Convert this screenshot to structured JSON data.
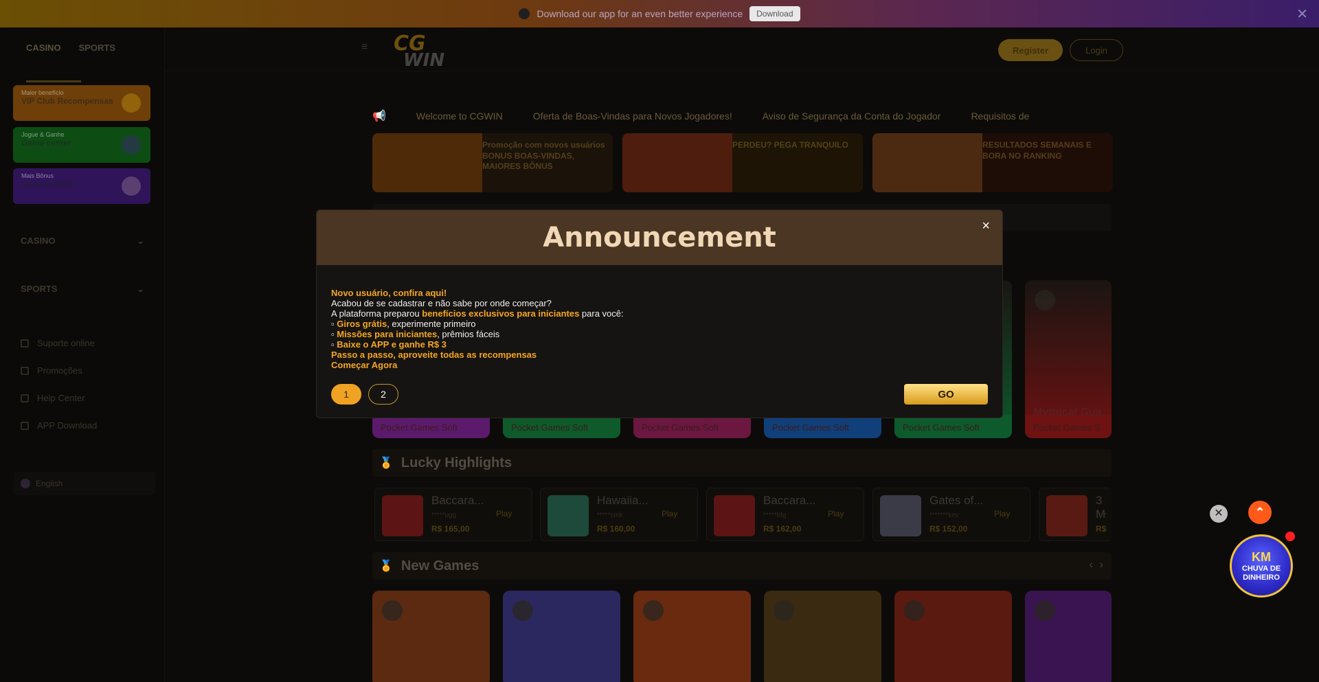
{
  "topbar": {
    "promo_text": "Download our app for an even better experience",
    "download_label": "Download",
    "close_glyph": "✕"
  },
  "sidebar": {
    "tabs": [
      {
        "label": "CASINO",
        "icon": "casino-icon"
      },
      {
        "label": "SPORTS",
        "icon": "sports-icon"
      }
    ],
    "promos": [
      {
        "sub": "Maior benefício",
        "label": "VIP Club Recompensas"
      },
      {
        "sub": "Jogue & Ganhe",
        "label": "Game center"
      },
      {
        "sub": "Mais Bônus",
        "label": "Invite Friends"
      }
    ],
    "sections": [
      "CASINO",
      "SPORTS"
    ],
    "links": [
      "Suporte online",
      "Promoções",
      "Help Center",
      "APP Download"
    ],
    "language": "English"
  },
  "header": {
    "logo_top": "CG",
    "logo_bottom": "WIN",
    "register_label": "Register",
    "login_label": "Login"
  },
  "marquee": [
    "Welcome to CGWIN",
    "Oferta de Boas-Vindas para Novos Jogadores!",
    "Aviso de Segurança da Conta do Jogador",
    "Requisitos de"
  ],
  "banners": [
    {
      "text": "Promoção com novos usuários BONUS BOAS-VINDAS, MAIORES BÔNUS"
    },
    {
      "text": "PERDEU? PEGA TRANQUILO"
    },
    {
      "text": "RESULTADOS SEMANAIS E BORA NO RANKING"
    }
  ],
  "games_row1": [
    {
      "name": "",
      "provider": "Pocket Games Soft",
      "color": "#5b1a6b"
    },
    {
      "name": "",
      "provider": "Pocket Games Soft",
      "color": "#0e5a2a"
    },
    {
      "name": "",
      "provider": "Pocket Games Soft",
      "color": "#6b1740"
    },
    {
      "name": "",
      "provider": "Pocket Games Soft",
      "color": "#103f7a"
    },
    {
      "name": "",
      "provider": "Pocket Games Soft",
      "color": "#0d5a2c"
    },
    {
      "name": "Mythical Gua",
      "provider": "Pocket Games S",
      "color": "#6e1212"
    }
  ],
  "lucky": {
    "title": "Lucky Highlights",
    "items": [
      {
        "name": "Baccara...",
        "user": "*****ugg",
        "amount": "R$ 165,00",
        "play": "Play",
        "color": "#5c1414"
      },
      {
        "name": "Hawaiia...",
        "user": "*****cmk",
        "amount": "R$ 160,00",
        "play": "Play",
        "color": "#1d4a3a"
      },
      {
        "name": "Baccara...",
        "user": "*****bfg",
        "amount": "R$ 162,00",
        "play": "Play",
        "color": "#5c1414"
      },
      {
        "name": "Gates of...",
        "user": "*******kev",
        "amount": "R$ 152,00",
        "play": "Play",
        "color": "#3b3a47"
      },
      {
        "name": "3 M",
        "user": "****",
        "amount": "R$",
        "play": "",
        "color": "#5a1a14"
      }
    ]
  },
  "new_games": {
    "title": "New Games",
    "prev": "‹",
    "next": "›",
    "tiles": [
      {
        "color": "#5b2a10"
      },
      {
        "color": "#2b2860"
      },
      {
        "color": "#6a2a10"
      },
      {
        "color": "#3a2a12"
      },
      {
        "color": "#5a1a10"
      },
      {
        "color": "#3a1450"
      }
    ]
  },
  "floating": {
    "close_glyph": "✕",
    "up_glyph": "⌃",
    "rain_logo": "KM",
    "rain_text": "CHUVA DE DINHEIRO"
  },
  "modal": {
    "title": "Announcement",
    "close_glyph": "×",
    "line1": "Novo usuário, confira aqui!",
    "line2": "Acabou de se cadastrar e não sabe por onde começar?",
    "line3_pre": "A plataforma preparou ",
    "line3_hl": "benefícios exclusivos para iniciantes",
    "line3_post": " para você:",
    "line4_hl": "Giros grátis",
    "line4_post": ", experimente primeiro",
    "line5_hl": "Missões para iniciantes",
    "line5_post": ", prêmios fáceis",
    "line6": "Baixe o APP e ganhe R$ 3",
    "line7": "Passo a passo, aproveite todas as recompensas",
    "line8": "Começar Agora",
    "pages": [
      "1",
      "2"
    ],
    "go_label": "GO"
  },
  "colors": {
    "accent": "#f5a623",
    "modal_header": "#4a3623",
    "go_button": "#f0a323"
  }
}
